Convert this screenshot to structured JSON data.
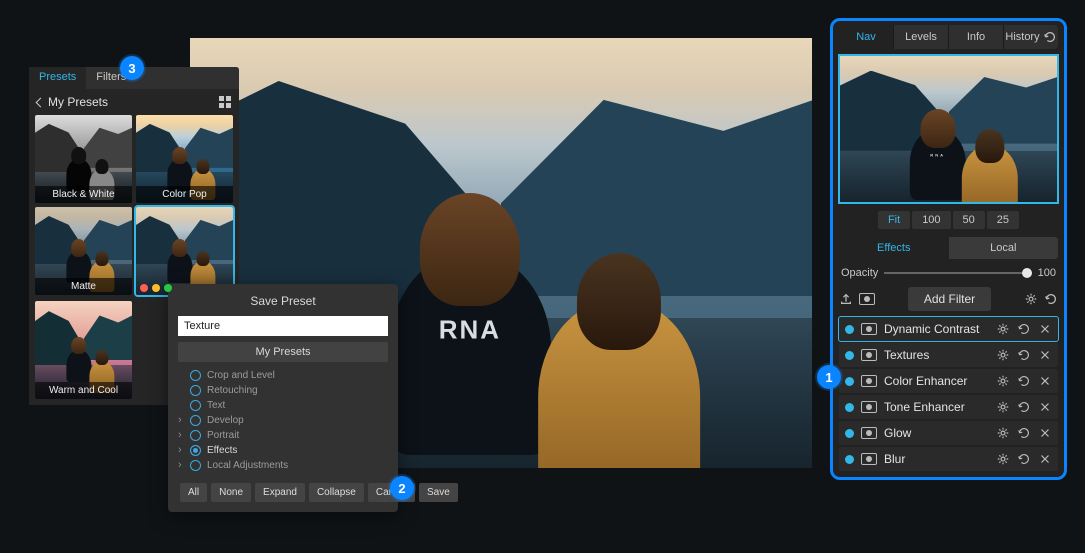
{
  "badges": {
    "b1": "1",
    "b2": "2",
    "b3": "3"
  },
  "presets_panel": {
    "tabs": {
      "presets": "Presets",
      "filters": "Filters"
    },
    "active_tab": "Presets",
    "header": "My Presets",
    "items": [
      {
        "label": "Black & White"
      },
      {
        "label": "Color Pop"
      },
      {
        "label": "Matte"
      },
      {
        "label": ""
      },
      {
        "label": "Warm and Cool"
      }
    ]
  },
  "save_preset": {
    "title": "Save Preset",
    "name_value": "Texture",
    "folder": "My Presets",
    "options": [
      {
        "label": "Crop and Level",
        "checked": false,
        "expandable": false
      },
      {
        "label": "Retouching",
        "checked": false,
        "expandable": false
      },
      {
        "label": "Text",
        "checked": false,
        "expandable": false
      },
      {
        "label": "Develop",
        "checked": false,
        "expandable": true
      },
      {
        "label": "Portrait",
        "checked": false,
        "expandable": true
      },
      {
        "label": "Effects",
        "checked": true,
        "expandable": true
      },
      {
        "label": "Local Adjustments",
        "checked": false,
        "expandable": true
      }
    ],
    "buttons": {
      "all": "All",
      "none": "None",
      "expand": "Expand",
      "collapse": "Collapse",
      "cancel": "Cancel",
      "save": "Save"
    }
  },
  "right_panel": {
    "tabs": {
      "nav": "Nav",
      "levels": "Levels",
      "info": "Info",
      "history": "History"
    },
    "active_top_tab": "Nav",
    "zoom": {
      "fit": "Fit",
      "z100": "100",
      "z50": "50",
      "z25": "25",
      "active": "Fit"
    },
    "mode": {
      "effects": "Effects",
      "local": "Local",
      "active": "Effects"
    },
    "opacity": {
      "label": "Opacity",
      "value": "100"
    },
    "add_filter": "Add Filter",
    "filters": [
      {
        "name": "Dynamic Contrast",
        "selected": true
      },
      {
        "name": "Textures"
      },
      {
        "name": "Color Enhancer"
      },
      {
        "name": "Tone Enhancer"
      },
      {
        "name": "Glow"
      },
      {
        "name": "Blur"
      }
    ]
  }
}
